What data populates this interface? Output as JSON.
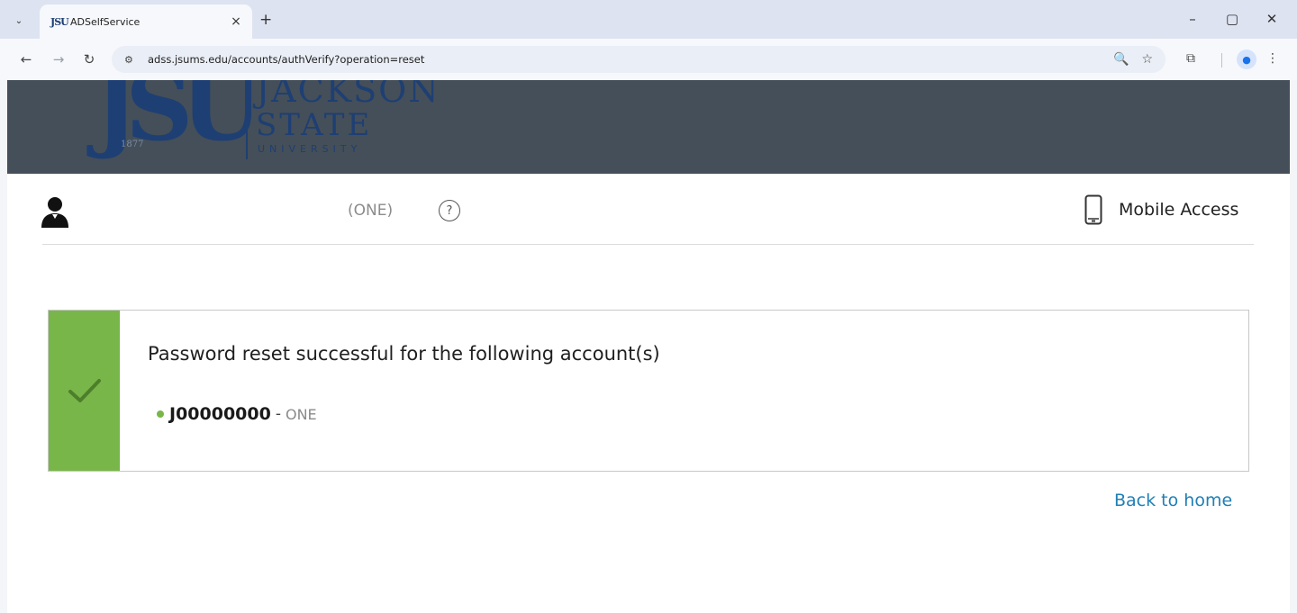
{
  "browser": {
    "tab_search_glyph": "⌄",
    "tab": {
      "favicon_text": "JSU",
      "title": "ADSelfService",
      "close_glyph": "×"
    },
    "new_tab_glyph": "+",
    "window": {
      "minimize_glyph": "–",
      "maximize_glyph": "▢",
      "close_glyph": "✕"
    },
    "nav": {
      "back_glyph": "←",
      "forward_glyph": "→",
      "reload_glyph": "↻"
    },
    "site_info_glyph": "⚙",
    "url": "adss.jsums.edu/accounts/authVerify?operation=reset",
    "zoom_glyph": "🔍",
    "bookmark_glyph": "☆",
    "extensions_glyph": "⧉",
    "profile_glyph": "●",
    "menu_glyph": "⋮"
  },
  "banner": {
    "logo_mark": "JSU",
    "logo_year": "1877",
    "logo_line1": "JACKSON",
    "logo_line2": "STATE",
    "logo_line3": "UNIVERSITY"
  },
  "header": {
    "domain": "(ONE)",
    "help_glyph": "?",
    "mobile_access_label": "Mobile Access"
  },
  "success": {
    "message": "Password reset successful for the following account(s)",
    "accounts": [
      {
        "id": "J00000000",
        "separator": "-",
        "domain": "ONE"
      }
    ]
  },
  "links": {
    "back_home": "Back to home"
  },
  "colors": {
    "banner_bg": "#444f59",
    "logo_blue": "#1e3f73",
    "success_green": "#79b64a",
    "link_blue": "#1f7fb6"
  }
}
